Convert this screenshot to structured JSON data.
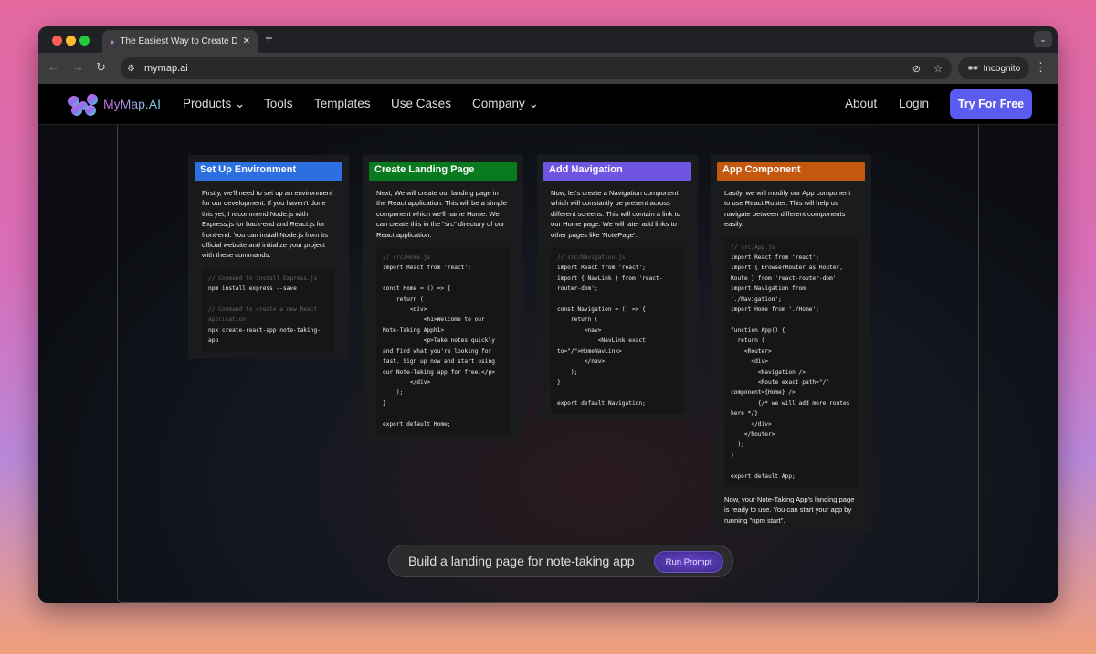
{
  "browser": {
    "tab_title": "The Easiest Way to Create Di",
    "url": "mymap.ai",
    "incognito_label": "Incognito"
  },
  "nav": {
    "brand": "MyMap.AI",
    "items": [
      "Products",
      "Tools",
      "Templates",
      "Use Cases",
      "Company"
    ],
    "about": "About",
    "login": "Login",
    "cta": "Try For Free",
    "cta_color": "#5b5bf0"
  },
  "cards": [
    {
      "title": "Set Up Environment",
      "color": "#2b6fe0",
      "desc": "Firstly, we'll need to set up an environment for our development. If you haven't done this yet, I recommend Node.js with Express.js for back-end and React.js for front-end. You can install Node.js from its official website and initialize your project with these commands:",
      "code": [
        "// Command to install Express.js",
        "npm install express --save",
        "",
        "// Command to create a new React application",
        "npx create-react-app note-taking-app"
      ],
      "after": ""
    },
    {
      "title": "Create Landing Page",
      "color": "#0a7a1e",
      "desc": "Next, We will create our landing page in the React application. This will be a simple component which we'll name Home. We can create this in the \"src\" directory of our React application.",
      "code": [
        "// src/Home.js",
        "import React from 'react';",
        "",
        "const Home = () => {",
        "    return (",
        "        <div>",
        "            <h1>Welcome to our Note-Taking Apph1>",
        "            <p>Take notes quickly and find what you're looking for fast. Sign up now and start using our Note-Taking app for free.</p>",
        "        </div>",
        "    );",
        "}",
        "",
        "export default Home;"
      ],
      "after": ""
    },
    {
      "title": "Add Navigation",
      "color": "#6f55e0",
      "desc": "Now, let's create a Navigation component which will constantly be present across different screens. This will contain a link to our Home page. We will later add links to other pages like 'NotePage'.",
      "code": [
        "// src/Navigation.js",
        "import React from 'react';",
        "import { NavLink } from 'react-router-dom';",
        "",
        "const Navigation = () => {",
        "    return (",
        "        <nav>",
        "            <NavLink exact to=\"/\">HomeNavLink>",
        "        </nav>",
        "    );",
        "}",
        "",
        "export default Navigation;"
      ],
      "after": ""
    },
    {
      "title": "App Component",
      "color": "#c4580e",
      "desc": "Lastly, we will modify our App component to use React Router. This will help us navigate between different components easily.",
      "code": [
        "// src/App.js",
        "import React from 'react';",
        "import { BrowserRouter as Router, Route } from 'react-router-dom';",
        "import Navigation from './Navigation';",
        "import Home from './Home';",
        "",
        "function App() {",
        "  return (",
        "    <Router>",
        "      <div>",
        "        <Navigation />",
        "        <Route exact path=\"/\" component={Home} />",
        "        {/* we will add more routes here */}",
        "      </div>",
        "    </Router>",
        "  );",
        "}",
        "",
        "export default App;"
      ],
      "after": "Now, your Note-Taking App's landing page is ready to use. You can start your app by running \"npm start\"."
    }
  ],
  "prompt": {
    "text": "Build a landing page for note-taking app",
    "button": "Run Prompt"
  }
}
